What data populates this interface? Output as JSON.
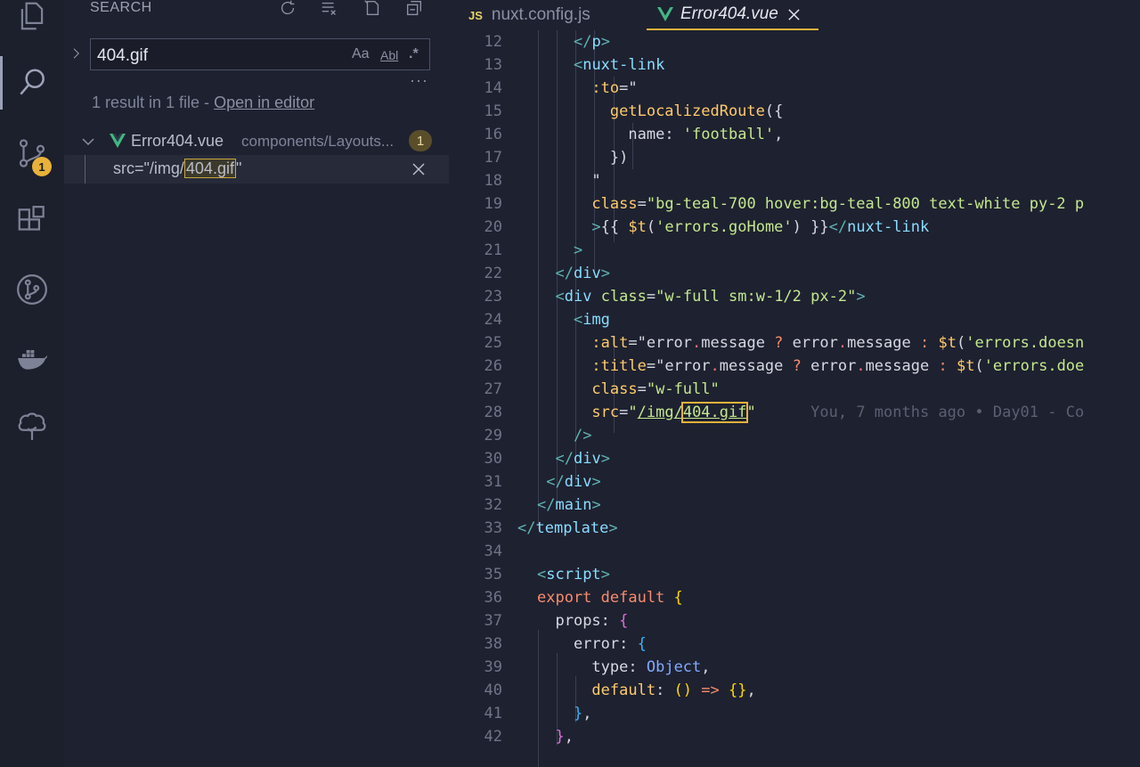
{
  "sidebar": {
    "title": "SEARCH",
    "search_value": "404.gif",
    "options": {
      "match_case": "Aa",
      "whole_word": "Abl",
      "regex": ".*"
    },
    "more": "···",
    "results_prefix": "1 result in 1 file - ",
    "open_in_editor": "Open in editor",
    "file": {
      "name": "Error404.vue",
      "path": "components/Layouts...",
      "count": "1"
    },
    "match": {
      "before": "src=\"/img/",
      "highlight": "404.gif",
      "after": "\""
    }
  },
  "activity": {
    "scm_badge": "1"
  },
  "tabs": [
    {
      "icon": "JS",
      "label": "nuxt.config.js"
    },
    {
      "label": "Error404.vue"
    }
  ],
  "editor": {
    "line_numbers": [
      "12",
      "13",
      "14",
      "15",
      "16",
      "17",
      "18",
      "19",
      "20",
      "21",
      "22",
      "23",
      "24",
      "25",
      "26",
      "27",
      "28",
      "29",
      "30",
      "31",
      "32",
      "33",
      "34",
      "35",
      "36",
      "37",
      "38",
      "39",
      "40",
      "41",
      "42"
    ],
    "blame": "You, 7 months ago • Day01 - Co"
  },
  "colors": {
    "accent": "#e8b23a",
    "background": "#1e2130",
    "vue_green": "#41b883"
  }
}
